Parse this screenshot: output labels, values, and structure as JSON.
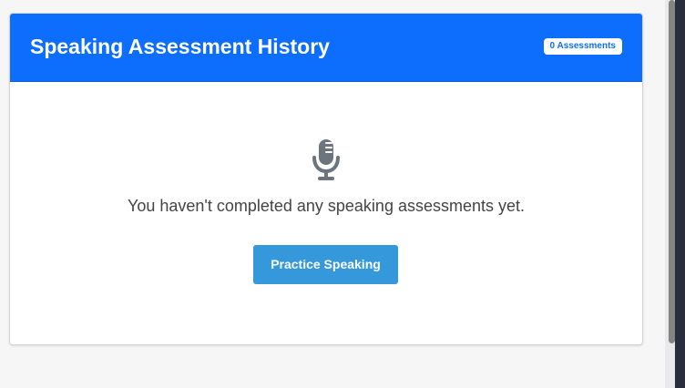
{
  "card": {
    "title": "Speaking Assessment History",
    "count_badge": "0 Assessments"
  },
  "empty_state": {
    "icon": "microphone-icon",
    "message": "You haven't completed any speaking assessments yet.",
    "action_label": "Practice Speaking"
  },
  "colors": {
    "header": "#0d6efd",
    "button": "#3498db",
    "icon": "#6c757d"
  }
}
